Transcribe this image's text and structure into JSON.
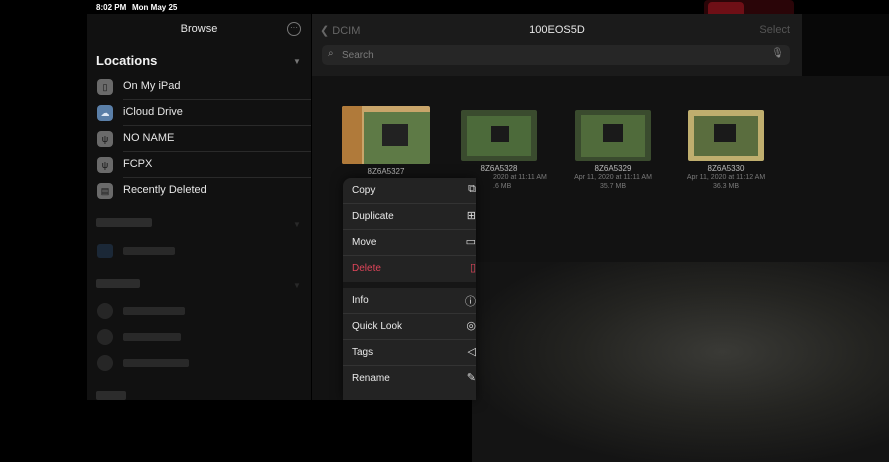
{
  "status": {
    "time": "8:02 PM",
    "date": "Mon May 25"
  },
  "sidebar": {
    "title": "Browse",
    "more_icon": "ellipsis-circle-icon",
    "locations": {
      "header": "Locations",
      "items": [
        {
          "label": "On My iPad",
          "icon": "ipad-icon"
        },
        {
          "label": "iCloud Drive",
          "icon": "cloud-icon"
        },
        {
          "label": "NO NAME",
          "icon": "usb-icon"
        },
        {
          "label": "FCPX",
          "icon": "usb-icon"
        },
        {
          "label": "Recently Deleted",
          "icon": "trash-icon"
        }
      ]
    }
  },
  "main": {
    "back_label": "DCIM",
    "title": "100EOS5D",
    "select_label": "Select",
    "search_placeholder": "Search",
    "files": [
      {
        "name": "8Z6A5327",
        "date": "",
        "size": ""
      },
      {
        "name": "8Z6A5328",
        "date": "2020 at 11:11 AM",
        "size": ".6 MB"
      },
      {
        "name": "8Z6A5329",
        "date": "Apr 11, 2020 at 11:11 AM",
        "size": "35.7 MB"
      },
      {
        "name": "8Z6A5330",
        "date": "Apr 11, 2020 at 11:12 AM",
        "size": "36.3 MB"
      }
    ]
  },
  "menu": {
    "items": [
      {
        "label": "Copy",
        "icon": "copy-icon"
      },
      {
        "label": "Duplicate",
        "icon": "duplicate-icon"
      },
      {
        "label": "Move",
        "icon": "folder-icon"
      },
      {
        "label": "Delete",
        "icon": "trash-icon"
      },
      {
        "label": "Info",
        "icon": "info-icon"
      },
      {
        "label": "Quick Look",
        "icon": "eye-icon"
      },
      {
        "label": "Tags",
        "icon": "tag-icon"
      },
      {
        "label": "Rename",
        "icon": "pencil-icon"
      }
    ]
  },
  "colors": {
    "danger": "#e0455a",
    "accent": "#0a84ff",
    "recording": "#6e0f16"
  }
}
